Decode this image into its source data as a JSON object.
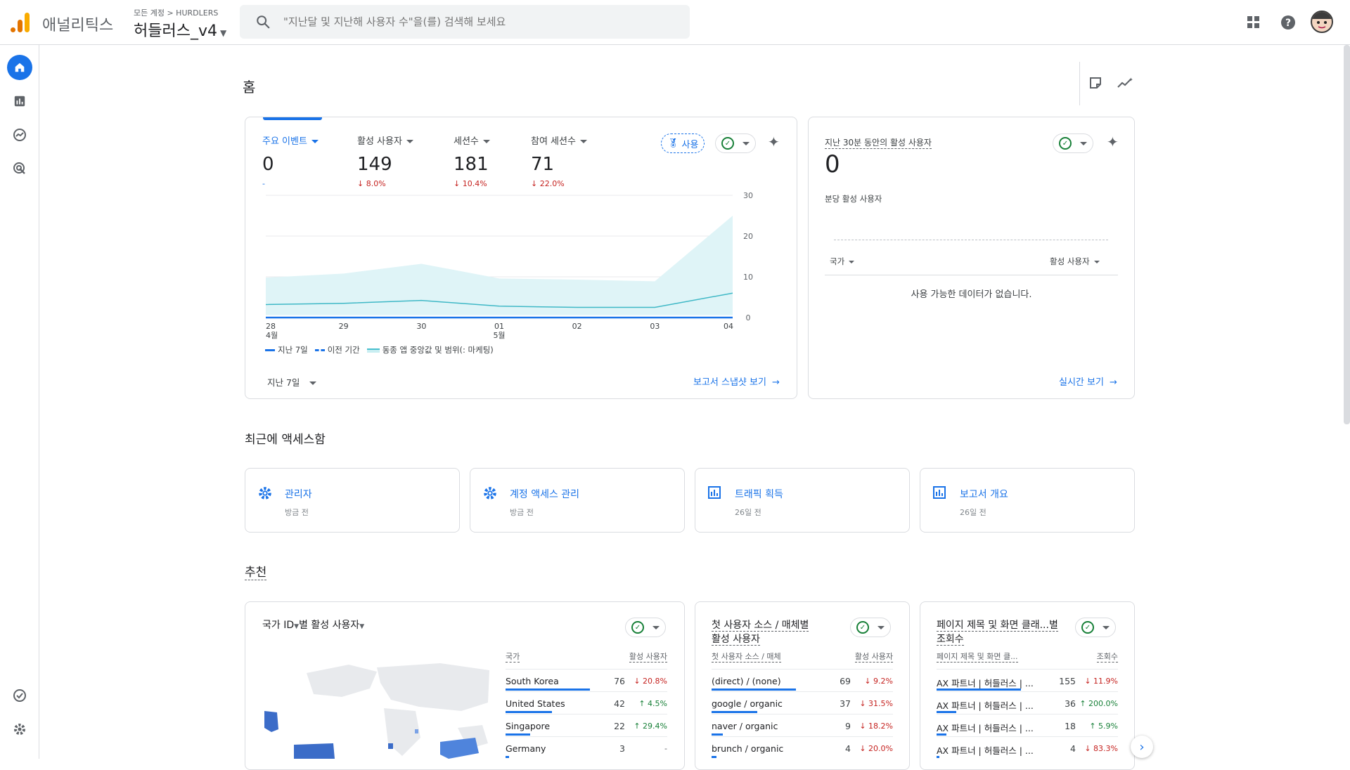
{
  "app": {
    "brand": "애널리틱스",
    "account_crumb": "모든 계정 > HURDLERS",
    "property": "허들러스_v4"
  },
  "search": {
    "placeholder": "\"지난달 및 지난해 사용자 수\"을(를) 검색해 보세요"
  },
  "colors": {
    "primary": "#1a73e8",
    "positive": "#188038",
    "negative": "#c5221f",
    "brand_orange": "#f9ab00",
    "brand_dark_orange": "#e37400"
  },
  "page": {
    "title": "홈"
  },
  "overview": {
    "metrics": [
      {
        "label": "주요 이벤트",
        "value": "0",
        "change": "-"
      },
      {
        "label": "활성 사용자",
        "value": "149",
        "change": "↓ 8.0%"
      },
      {
        "label": "세션수",
        "value": "181",
        "change": "↓ 10.4%"
      },
      {
        "label": "참여 세션수",
        "value": "71",
        "change": "↓ 22.0%"
      }
    ],
    "usage_badge": "사용",
    "y_ticks": [
      "30",
      "20",
      "10",
      "0"
    ],
    "x_ticks": [
      {
        "day": "28",
        "month": "4월"
      },
      {
        "day": "29",
        "month": ""
      },
      {
        "day": "30",
        "month": ""
      },
      {
        "day": "01",
        "month": "5월"
      },
      {
        "day": "02",
        "month": ""
      },
      {
        "day": "03",
        "month": ""
      },
      {
        "day": "04",
        "month": ""
      }
    ],
    "legend": [
      "지난 7일",
      "이전 기간",
      "동종 앱 중앙값 및 범위(: 마케팅)"
    ],
    "date_range": "지난 7일",
    "link": "보고서 스냅샷 보기"
  },
  "chart_data": {
    "type": "line",
    "x": [
      "04-28",
      "04-29",
      "04-30",
      "05-01",
      "05-02",
      "05-03",
      "05-04"
    ],
    "series": [
      {
        "name": "지난 7일",
        "values": [
          0,
          0,
          0,
          0,
          0,
          0,
          0
        ]
      },
      {
        "name": "동종 앱 중앙값 및 범위(: 마케팅)",
        "values": [
          3.2,
          3.5,
          4.2,
          2.8,
          2.5,
          2.5,
          6.0
        ],
        "range_low": [
          0.6,
          0.6,
          0.6,
          0.6,
          0.6,
          0.6,
          0.6
        ],
        "range_high": [
          9.8,
          10.8,
          13.2,
          9.6,
          9.3,
          8.9,
          25.0
        ]
      }
    ],
    "ylim": [
      0,
      30
    ]
  },
  "realtime": {
    "title": "지난 30분 동안의 활성 사용자",
    "value": "0",
    "per_minute_label": "분당 활성 사용자",
    "col_country": "국가",
    "col_users": "활성 사용자",
    "empty": "사용 가능한 데이터가 없습니다.",
    "link": "실시간 보기"
  },
  "recent": {
    "title": "최근에 액세스함",
    "items": [
      {
        "title": "관리자",
        "sub": "방금 전",
        "icon": "gear-icon"
      },
      {
        "title": "계정 액세스 관리",
        "sub": "방금 전",
        "icon": "gear-icon"
      },
      {
        "title": "트래픽 획득",
        "sub": "26일 전",
        "icon": "report-icon"
      },
      {
        "title": "보고서 개요",
        "sub": "26일 전",
        "icon": "report-icon"
      }
    ]
  },
  "recommend": {
    "title": "추천",
    "country_card": {
      "title_a": "국가 ID",
      "title_b": "별 활성 사용자",
      "col_name": "국가",
      "col_value": "활성 사용자",
      "rows": [
        {
          "name": "South Korea",
          "value": "76",
          "change": "↓ 20.8%",
          "dir": "down",
          "share": 1.0
        },
        {
          "name": "United States",
          "value": "42",
          "change": "↑ 4.5%",
          "dir": "up",
          "share": 0.55
        },
        {
          "name": "Singapore",
          "value": "22",
          "change": "↑ 29.4%",
          "dir": "up",
          "share": 0.29
        },
        {
          "name": "Germany",
          "value": "3",
          "change": "-",
          "dir": "neu",
          "share": 0.04
        }
      ]
    },
    "source_card": {
      "title_line1": "첫 사용자 소스 / 매체별",
      "title_line2": "활성 사용자",
      "col_name": "첫 사용자 소스 / 매체",
      "col_value": "활성 사용자",
      "rows": [
        {
          "name": "(direct) / (none)",
          "value": "69",
          "change": "↓ 9.2%",
          "dir": "down",
          "share": 1.0
        },
        {
          "name": "google / organic",
          "value": "37",
          "change": "↓ 31.5%",
          "dir": "down",
          "share": 0.54
        },
        {
          "name": "naver / organic",
          "value": "9",
          "change": "↓ 18.2%",
          "dir": "down",
          "share": 0.13
        },
        {
          "name": "brunch / organic",
          "value": "4",
          "change": "↓ 20.0%",
          "dir": "down",
          "share": 0.06
        }
      ]
    },
    "page_card": {
      "title_line1": "페이지 제목 및 화면 클래...별",
      "title_line2": "조회수",
      "col_name": "페이지 제목 및 화면 클...",
      "col_value": "조회수",
      "rows": [
        {
          "name": "AX 파트너 | 허들러스 | ...",
          "value": "155",
          "change": "↓ 11.9%",
          "dir": "down",
          "share": 1.0
        },
        {
          "name": "AX 파트너 | 허들러스 | ...",
          "value": "36",
          "change": "↑ 200.0%",
          "dir": "up",
          "share": 0.23
        },
        {
          "name": "AX 파트너 | 허들러스 | ...",
          "value": "18",
          "change": "↑ 5.9%",
          "dir": "up",
          "share": 0.12
        },
        {
          "name": "AX 파트너 | 허들러스 | ...",
          "value": "4",
          "change": "↓ 83.3%",
          "dir": "down",
          "share": 0.03
        }
      ]
    }
  }
}
